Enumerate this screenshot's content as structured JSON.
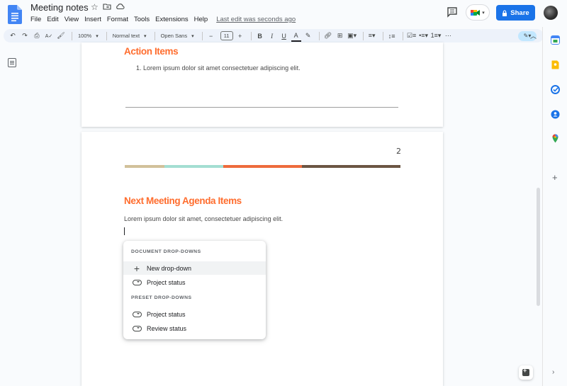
{
  "app": {
    "title": "Meeting notes",
    "icons": {
      "logo": "google-docs-logo",
      "star": "star-icon",
      "folder": "move-folder-icon",
      "cloud": "cloud-status-icon"
    }
  },
  "menu": {
    "items": [
      "File",
      "Edit",
      "View",
      "Insert",
      "Format",
      "Tools",
      "Extensions",
      "Help"
    ],
    "last_edit": "Last edit was seconds ago"
  },
  "header": {
    "share_label": "Share",
    "share_color": "#1a73e8"
  },
  "toolbar": {
    "zoom": "100%",
    "style": "Normal text",
    "font": "Open Sans",
    "font_size": "11",
    "bold": "B",
    "italic": "I",
    "underline": "U",
    "text_color": "A"
  },
  "document": {
    "page1": {
      "heading": "Action Items",
      "list_item": "1.   Lorem ipsum dolor sit amet consectetuer adipiscing elit."
    },
    "page2": {
      "page_number": "2",
      "heading": "Next Meeting Agenda Items",
      "body": "Lorem ipsum dolor sit amet, consectetuer adipiscing elit.",
      "colorbar": [
        "#d1c19a",
        "#a4ded2",
        "#ee6b3c",
        "#6b5543"
      ]
    },
    "heading_color": "#ff6d2e"
  },
  "dropdown_menu": {
    "document_section": "DOCUMENT DROP-DOWNS",
    "new_dropdown": "New drop-down",
    "doc_items": [
      "Project status"
    ],
    "preset_section": "PRESET DROP-DOWNS",
    "preset_items": [
      "Project status",
      "Review status"
    ]
  }
}
